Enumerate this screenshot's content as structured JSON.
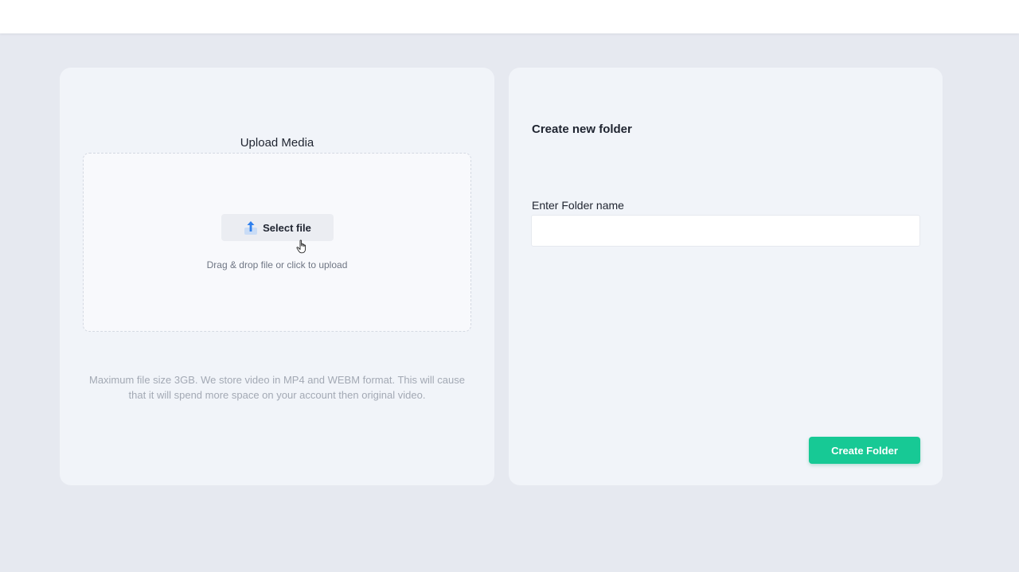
{
  "upload": {
    "title": "Upload Media",
    "select_button_label": "Select file",
    "select_button_icon": "upload-arrow-icon",
    "drop_hint": "Drag & drop file or click to upload",
    "file_note": "Maximum file size 3GB. We store video in MP4 and WEBM format. This will cause that it will spend more space on your account then original video."
  },
  "folder": {
    "title": "Create new folder",
    "input_label": "Enter Folder name",
    "input_value": "",
    "input_placeholder": "",
    "submit_label": "Create Folder"
  },
  "colors": {
    "background": "#e6e9f0",
    "card": "#f1f4f9",
    "accent_green": "#17c995",
    "upload_icon_blue": "#2f80ed"
  }
}
